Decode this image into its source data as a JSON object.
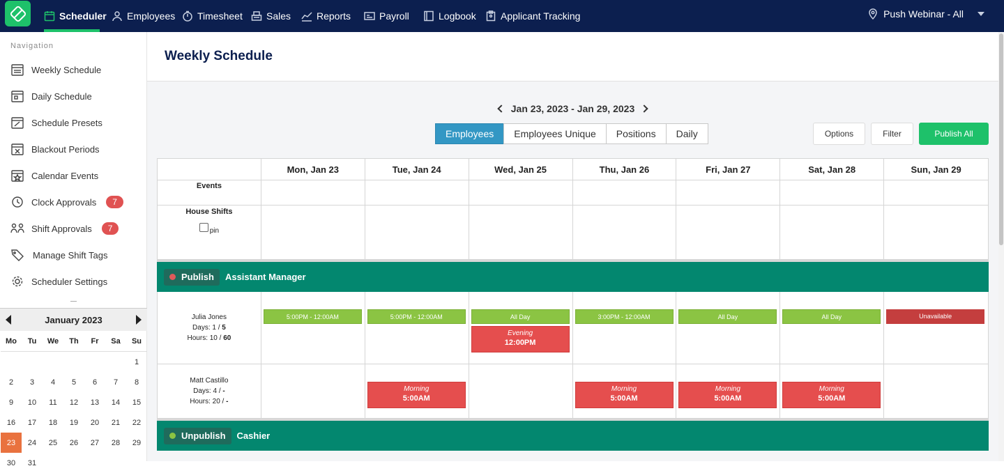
{
  "topnav": {
    "items": [
      {
        "label": "Scheduler",
        "icon": "calendar-icon"
      },
      {
        "label": "Employees",
        "icon": "user-icon"
      },
      {
        "label": "Timesheet",
        "icon": "stopwatch-icon"
      },
      {
        "label": "Sales",
        "icon": "register-icon"
      },
      {
        "label": "Reports",
        "icon": "chart-icon"
      },
      {
        "label": "Payroll",
        "icon": "payroll-icon"
      },
      {
        "label": "Logbook",
        "icon": "book-icon"
      },
      {
        "label": "Applicant Tracking",
        "icon": "clipboard-icon"
      }
    ],
    "location": "Push Webinar - All"
  },
  "sidebar": {
    "title": "Navigation",
    "items": [
      {
        "label": "Weekly Schedule"
      },
      {
        "label": "Daily Schedule"
      },
      {
        "label": "Schedule Presets"
      },
      {
        "label": "Blackout Periods"
      },
      {
        "label": "Calendar Events"
      },
      {
        "label": "Clock Approvals",
        "badge": "7"
      },
      {
        "label": "Shift Approvals",
        "badge": "7"
      },
      {
        "label": "Manage Shift Tags"
      },
      {
        "label": "Scheduler Settings"
      }
    ]
  },
  "calendar": {
    "month": "January 2023",
    "dow": [
      "Mo",
      "Tu",
      "We",
      "Th",
      "Fr",
      "Sa",
      "Su"
    ],
    "days": [
      "",
      "",
      "",
      "",
      "",
      "",
      "1",
      "2",
      "3",
      "4",
      "5",
      "6",
      "7",
      "8",
      "9",
      "10",
      "11",
      "12",
      "13",
      "14",
      "15",
      "16",
      "17",
      "18",
      "19",
      "20",
      "21",
      "22",
      "23",
      "24",
      "25",
      "26",
      "27",
      "28",
      "29",
      "30",
      "31"
    ],
    "selected": "23"
  },
  "page": {
    "title": "Weekly Schedule",
    "date_range": "Jan 23, 2023 - Jan 29, 2023",
    "tabs": [
      "Employees",
      "Employees Unique",
      "Positions",
      "Daily"
    ],
    "active_tab": "Employees",
    "options_label": "Options",
    "filter_label": "Filter",
    "publish_all_label": "Publish All"
  },
  "grid": {
    "days": [
      "Mon, Jan 23",
      "Tue, Jan 24",
      "Wed, Jan 25",
      "Thu, Jan 26",
      "Fri, Jan 27",
      "Sat, Jan 28",
      "Sun, Jan 29"
    ],
    "events_label": "Events",
    "house_shifts_label": "House Shifts",
    "pin_label": "pin",
    "sections": [
      {
        "button": "Publish",
        "dot_color": "#e05a5a",
        "title": "Assistant Manager",
        "employees": [
          {
            "name": "Julia Jones",
            "days_text": "Days: 1 / ",
            "days_max": "5",
            "hours_text": "Hours: 10 / ",
            "hours_max": "60",
            "shifts": [
              [
                {
                  "kind": "g",
                  "time": "5:00PM - 12:00AM"
                }
              ],
              [
                {
                  "kind": "g",
                  "time": "5:00PM - 12:00AM"
                }
              ],
              [
                {
                  "kind": "g",
                  "time": "All Day"
                },
                {
                  "kind": "r",
                  "tag": "Evening",
                  "time": "12:00PM"
                }
              ],
              [
                {
                  "kind": "g",
                  "time": "3:00PM - 12:00AM"
                }
              ],
              [
                {
                  "kind": "g",
                  "time": "All Day"
                }
              ],
              [
                {
                  "kind": "g",
                  "time": "All Day"
                }
              ],
              [
                {
                  "kind": "u",
                  "time": "Unavailable"
                }
              ]
            ]
          },
          {
            "name": "Matt Castillo",
            "days_text": "Days: 4 / ",
            "days_max": "-",
            "hours_text": "Hours: 20 / ",
            "hours_max": "-",
            "shifts": [
              [],
              [
                {
                  "kind": "r",
                  "tag": "Morning",
                  "time": "5:00AM"
                }
              ],
              [],
              [
                {
                  "kind": "r",
                  "tag": "Morning",
                  "time": "5:00AM"
                }
              ],
              [
                {
                  "kind": "r",
                  "tag": "Morning",
                  "time": "5:00AM"
                }
              ],
              [
                {
                  "kind": "r",
                  "tag": "Morning",
                  "time": "5:00AM"
                }
              ],
              []
            ]
          }
        ]
      },
      {
        "button": "Unpublish",
        "dot_color": "#8bc443",
        "title": "Cashier",
        "employees": []
      }
    ]
  }
}
